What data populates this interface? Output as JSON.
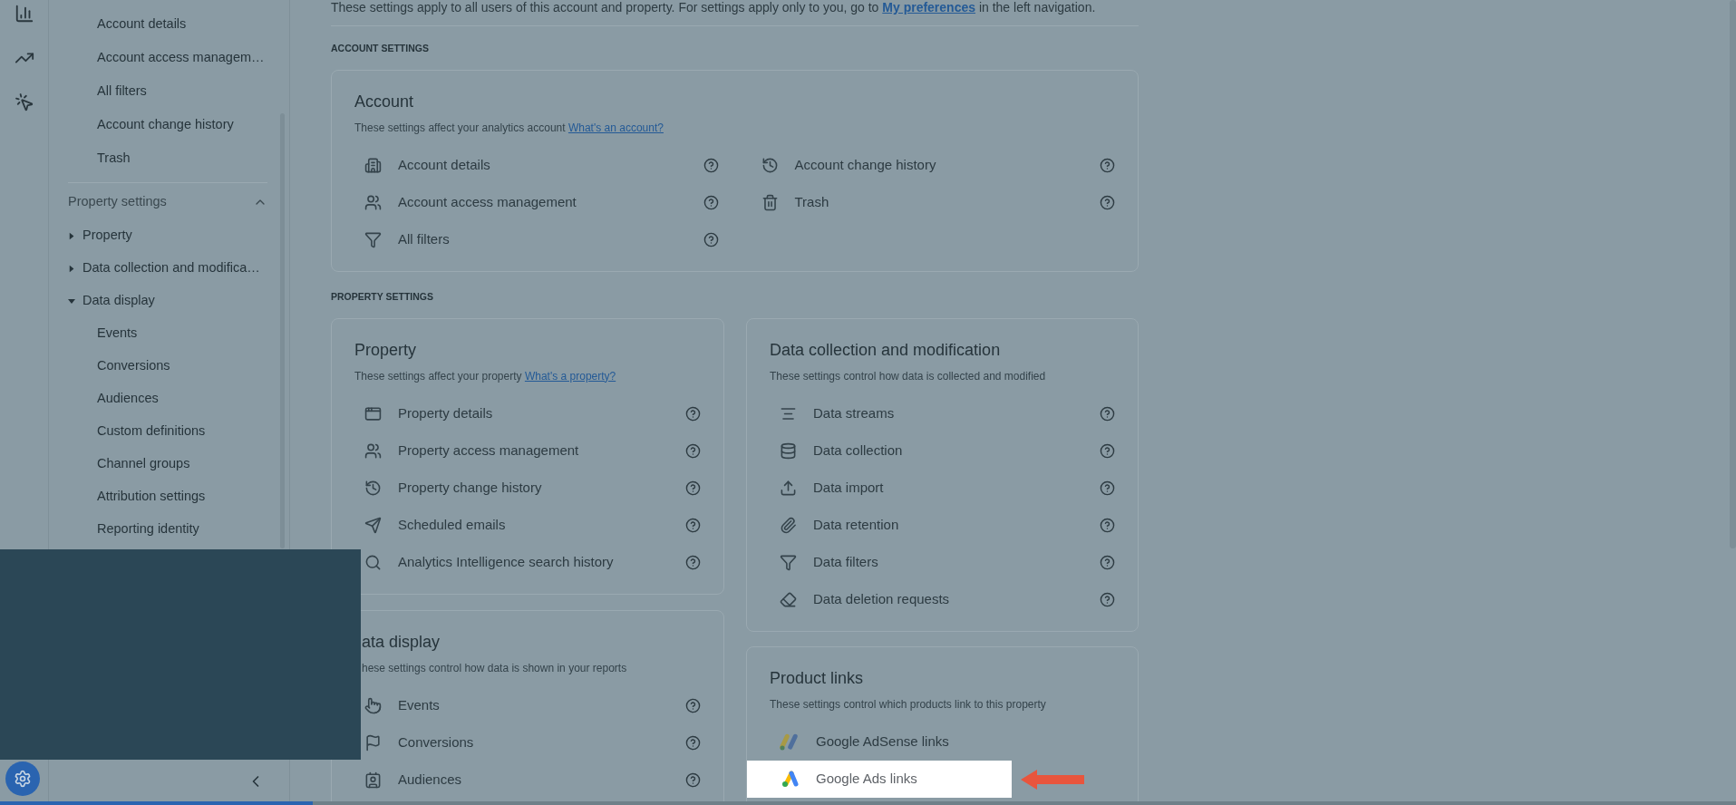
{
  "intro": {
    "before": "These settings apply to all users of this account and property. For settings apply only to you, go to ",
    "link": "My preferences",
    "after": " in the left navigation."
  },
  "sidebar": {
    "account_items": [
      "Account details",
      "Account access managem…",
      "All filters",
      "Account change history",
      "Trash"
    ],
    "section": {
      "label": "Property settings",
      "expanded": true
    },
    "tree": [
      {
        "label": "Property",
        "expanded": false
      },
      {
        "label": "Data collection and modifica…",
        "expanded": false
      },
      {
        "label": "Data display",
        "expanded": true,
        "children": [
          "Events",
          "Conversions",
          "Audiences",
          "Custom definitions",
          "Channel groups",
          "Attribution settings",
          "Reporting identity"
        ]
      }
    ]
  },
  "sections": [
    {
      "heading": "ACCOUNT SETTINGS",
      "cards": [
        {
          "kind": "settings",
          "title": "Account",
          "description": "These settings affect your analytics account",
          "link": "What's an account?",
          "columns": [
            [
              "Account details",
              "Account access management",
              "All filters"
            ],
            [
              "Account change history",
              "Trash"
            ]
          ]
        }
      ]
    },
    {
      "heading": "PROPERTY SETTINGS",
      "cards": [
        {
          "kind": "settings",
          "title": "Property",
          "description": "These settings affect your property",
          "link": "What's a property?",
          "columns": [
            [
              "Property details",
              "Property access management",
              "Property change history",
              "Scheduled emails",
              "Analytics Intelligence search history"
            ]
          ]
        },
        {
          "kind": "settings",
          "title": "ata display",
          "description": "hese settings control how data is shown in your reports",
          "columns": [
            [
              "Events",
              "Conversions",
              "Audiences"
            ]
          ]
        },
        {
          "kind": "settings",
          "title": "Data collection and modification",
          "description": "These settings control how data is collected and modified",
          "columns": [
            [
              "Data streams",
              "Data collection",
              "Data import",
              "Data retention",
              "Data filters",
              "Data deletion requests"
            ]
          ]
        },
        {
          "kind": "links",
          "title": "Product links",
          "description": "These settings control which products link to this property",
          "items": [
            {
              "label": "Google AdSense links",
              "highlighted": false
            },
            {
              "label": "Google Ads links",
              "highlighted": true
            }
          ]
        }
      ]
    }
  ],
  "progress": {
    "level": 0.18
  }
}
